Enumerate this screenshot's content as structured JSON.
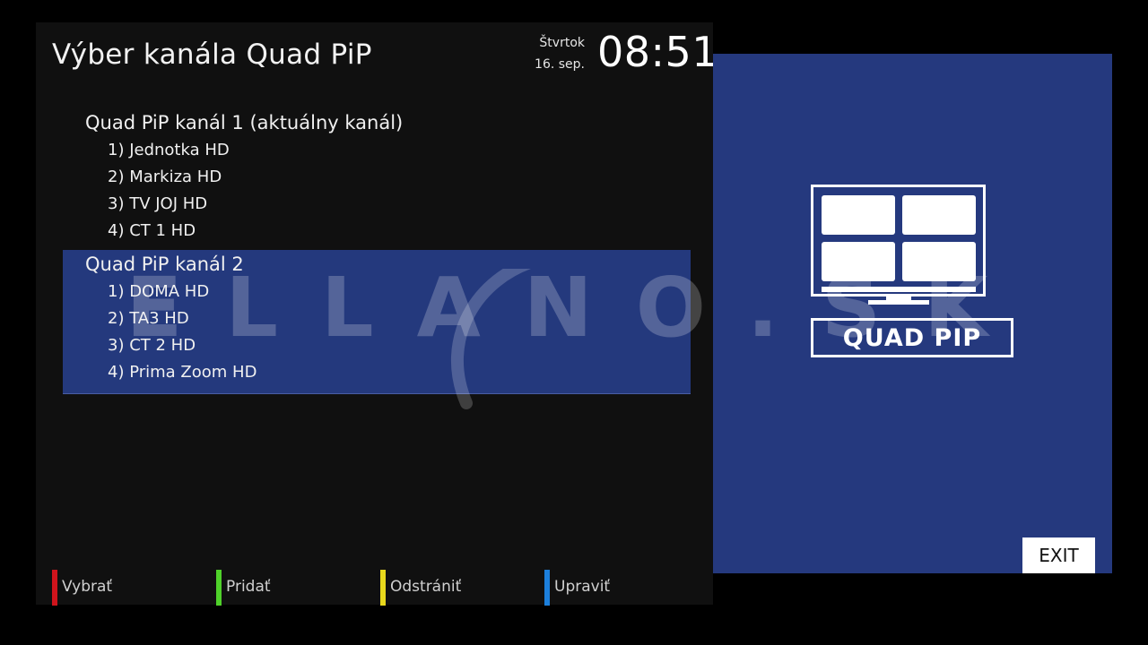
{
  "header": {
    "title": "Výber kanála Quad PiP",
    "weekday": "Štvrtok",
    "date": "16. sep.",
    "time": "08:51"
  },
  "groups": [
    {
      "label": "Quad PiP kanál 1 (aktuálny kanál)",
      "selected": false,
      "channels": [
        "1) Jednotka HD",
        "2) Markiza HD",
        "3) TV JOJ HD",
        "4) CT 1 HD"
      ]
    },
    {
      "label": "Quad PiP kanál 2",
      "selected": true,
      "channels": [
        "1) DOMA HD",
        "2) TA3 HD",
        "3) CT 2 HD",
        "4) Prima Zoom HD"
      ]
    }
  ],
  "watermark": {
    "text": "ELLANO.SK"
  },
  "footer": [
    {
      "label": "Vybrať",
      "color": "#d0141c"
    },
    {
      "label": "Pridať",
      "color": "#4fd12a"
    },
    {
      "label": "Odstrániť",
      "color": "#e8d81c"
    },
    {
      "label": "Upraviť",
      "color": "#1c7fdc"
    }
  ],
  "preview": {
    "logo_text": "QUAD PIP",
    "logo_icon": "quad-screen-monitor-icon",
    "exit_label": "EXIT",
    "background_color": "#25397e"
  }
}
